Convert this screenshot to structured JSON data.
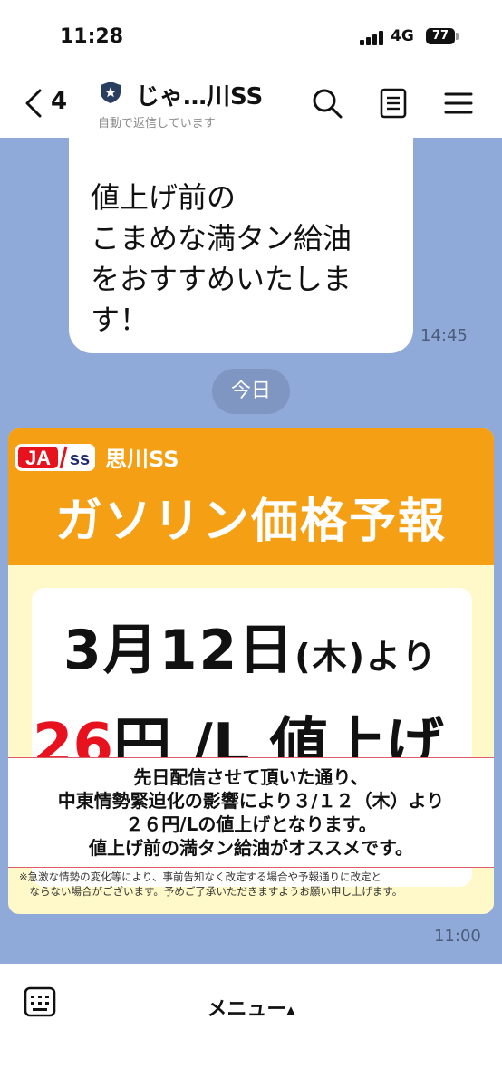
{
  "status_bar": {
    "time": "11:28",
    "network": "4G",
    "battery": "77"
  },
  "header": {
    "back_count": "4",
    "title": "じゃ…川SS",
    "subtitle": "自動で返信しています",
    "icons": [
      "back-chevron-icon",
      "shield-icon",
      "search-icon",
      "notes-icon",
      "menu-icon"
    ]
  },
  "messages": [
    {
      "text": "値上げ前の\nこまめな満タン給油\nをおすすめいたしま\nす！",
      "time": "14:45"
    }
  ],
  "date_divider": "今日",
  "card": {
    "logo_text_1": "JA",
    "logo_text_2": "ss",
    "store": "思川SS",
    "title": "ガソリン価格予報",
    "date_main": "3月12日",
    "date_weekday": "(木)",
    "date_suffix": "より",
    "price_amount": "26",
    "price_unit": "円 /L 値上げ",
    "notice": "先日配信させて頂いた通り、\n中東情勢緊迫化の影響により３/１２（木）より\n２６円/Lの値上げとなります。\n値上げ前の満タン給油がオススメです。",
    "footnote": "※急激な情勢の変化等により、事前告知なく改定する場合や予報通りに改定と\n　ならない場合がございます。予めご了承いただきますようお願い申し上げます。",
    "time": "11:00"
  },
  "bottom_bar": {
    "menu_label": "メニュー",
    "caret": "▲"
  },
  "colors": {
    "chat_bg": "#8fa9d8",
    "card_orange": "#f5a014",
    "price_red": "#e8121f",
    "ja_red": "#e8121f"
  }
}
